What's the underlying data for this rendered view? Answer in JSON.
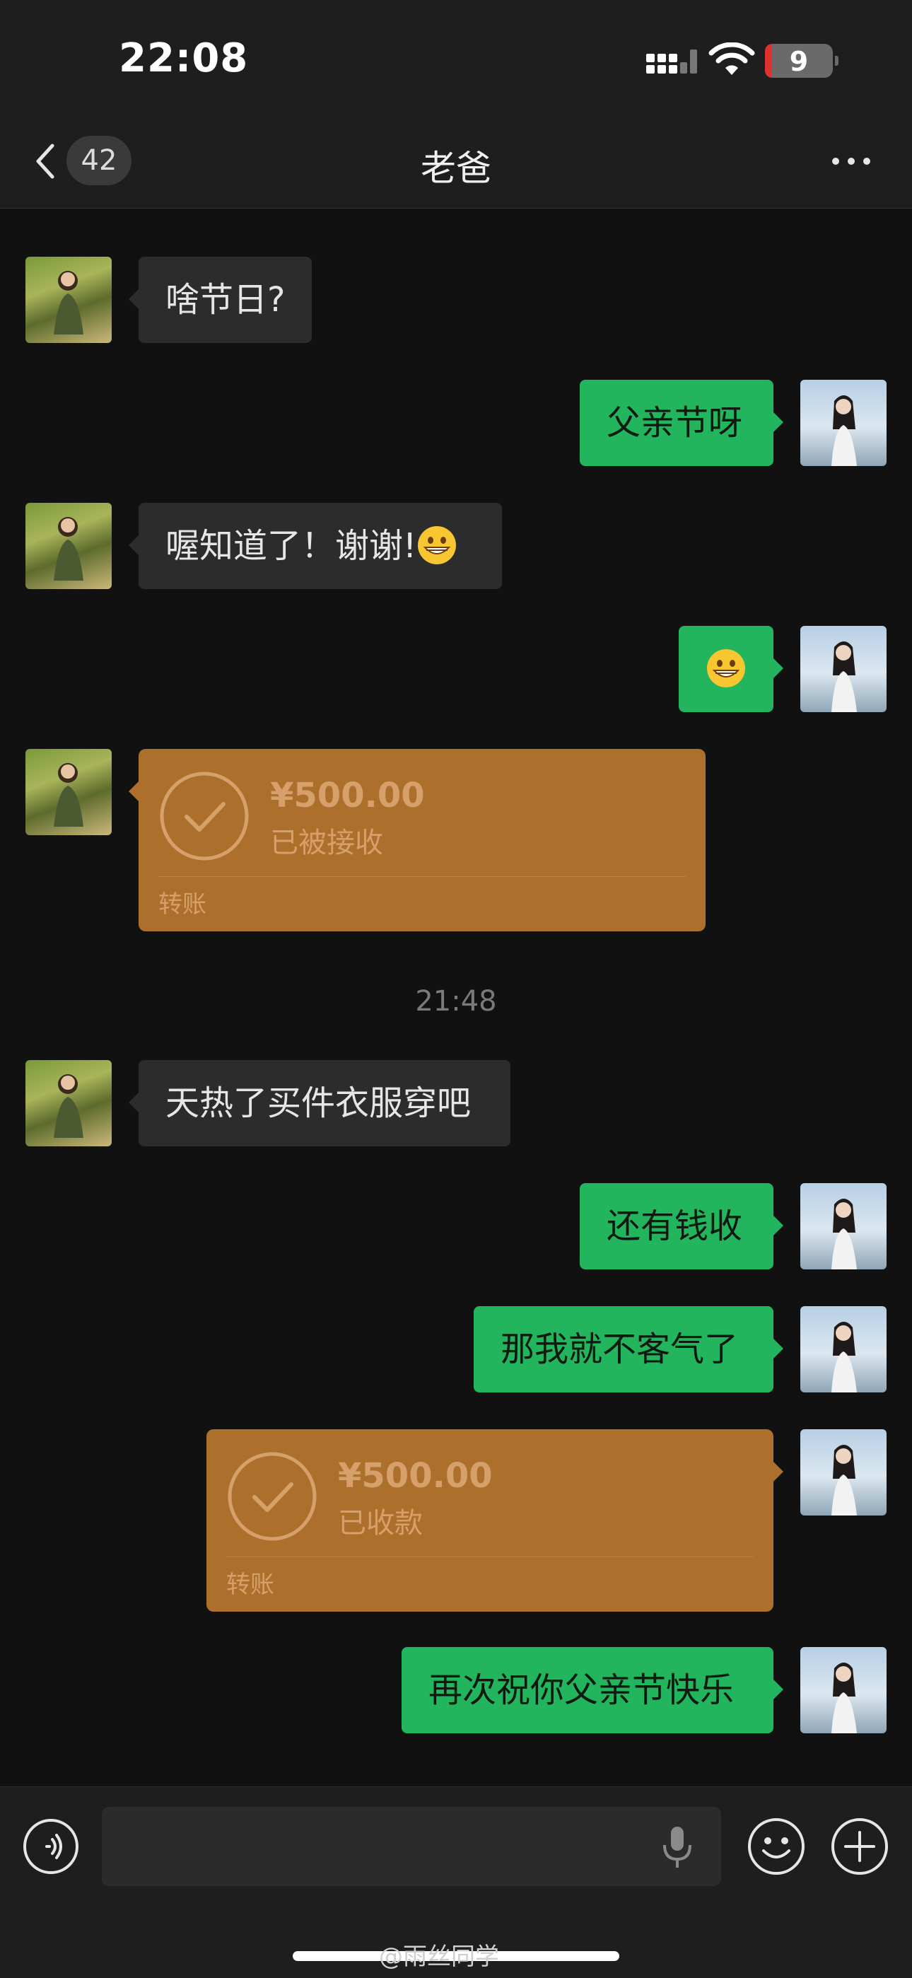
{
  "status_bar": {
    "time": "22:08",
    "battery": "9"
  },
  "header": {
    "unread_count": "42",
    "title": "老爸"
  },
  "messages": [
    {
      "side": "left",
      "text": "啥节日?"
    },
    {
      "side": "right",
      "text": "父亲节呀"
    },
    {
      "side": "left",
      "text": "喔知道了！谢谢!",
      "emoji": "grinning-face"
    },
    {
      "side": "right",
      "emoji": "grinning-face"
    },
    {
      "side": "left",
      "type": "transfer",
      "amount": "¥500.00",
      "status": "已被接收",
      "label": "转账"
    },
    {
      "type": "timestamp",
      "text": "21:48"
    },
    {
      "side": "left",
      "text": "天热了买件衣服穿吧"
    },
    {
      "side": "right",
      "text": "还有钱收"
    },
    {
      "side": "right",
      "text": "那我就不客气了"
    },
    {
      "side": "right",
      "type": "transfer",
      "amount": "¥500.00",
      "status": "已收款",
      "label": "转账"
    },
    {
      "side": "right",
      "text": "再次祝你父亲节快乐"
    }
  ],
  "watermark": "@雨丝同学",
  "colors": {
    "sent_bubble": "#22b55e",
    "received_bubble": "#2c2c2c",
    "transfer_card": "#ad6f2c",
    "background": "#111111"
  }
}
